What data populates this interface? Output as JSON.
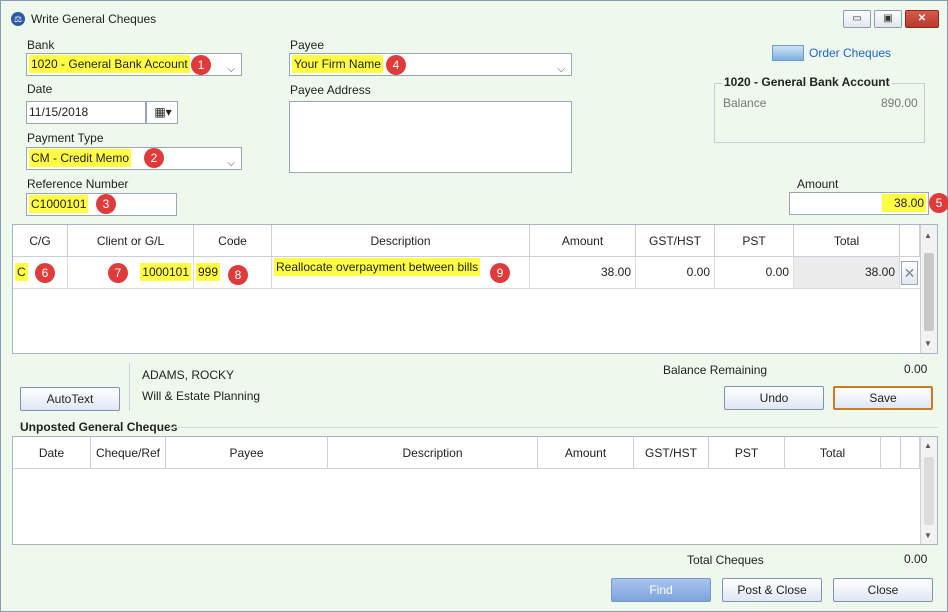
{
  "window": {
    "title": "Write General Cheques",
    "min": "▭",
    "max": "▣",
    "close": "✕"
  },
  "form": {
    "bank_label": "Bank",
    "bank_value": "1020 - General Bank Account",
    "date_label": "Date",
    "date_value": "11/15/2018",
    "payment_type_label": "Payment Type",
    "payment_type_value": "CM - Credit Memo",
    "reference_label": "Reference Number",
    "reference_value": "C1000101",
    "payee_label": "Payee",
    "payee_value": "Your Firm Name",
    "payee_address_label": "Payee Address",
    "payee_address_value": "",
    "amount_label": "Amount",
    "amount_value": "38.00"
  },
  "order_cheques_label": "Order Cheques",
  "account_box": {
    "title": "1020 - General Bank Account",
    "balance_label": "Balance",
    "balance_value": "890.00"
  },
  "badges": [
    "1",
    "2",
    "3",
    "4",
    "5",
    "6",
    "7",
    "8",
    "9"
  ],
  "entry_grid": {
    "headers": [
      "C/G",
      "Client or G/L",
      "Code",
      "Description",
      "Amount",
      "GST/HST",
      "PST",
      "Total"
    ],
    "row": {
      "cg": "C",
      "client": "1000101",
      "code": "999",
      "description": "Reallocate overpayment between bills",
      "amount": "38.00",
      "gst": "0.00",
      "pst": "0.00",
      "total": "38.00"
    }
  },
  "client_info": {
    "name": "ADAMS, ROCKY",
    "matter": "Will & Estate Planning"
  },
  "balance_remaining": {
    "label": "Balance Remaining",
    "value": "0.00"
  },
  "buttons": {
    "autotext": "AutoText",
    "undo": "Undo",
    "save": "Save",
    "find": "Find",
    "post_close": "Post & Close",
    "close": "Close"
  },
  "unposted": {
    "title": "Unposted General Cheques",
    "headers": [
      "Date",
      "Cheque/Ref",
      "Payee",
      "Description",
      "Amount",
      "GST/HST",
      "PST",
      "Total"
    ]
  },
  "total_cheques": {
    "label": "Total Cheques",
    "value": "0.00"
  }
}
